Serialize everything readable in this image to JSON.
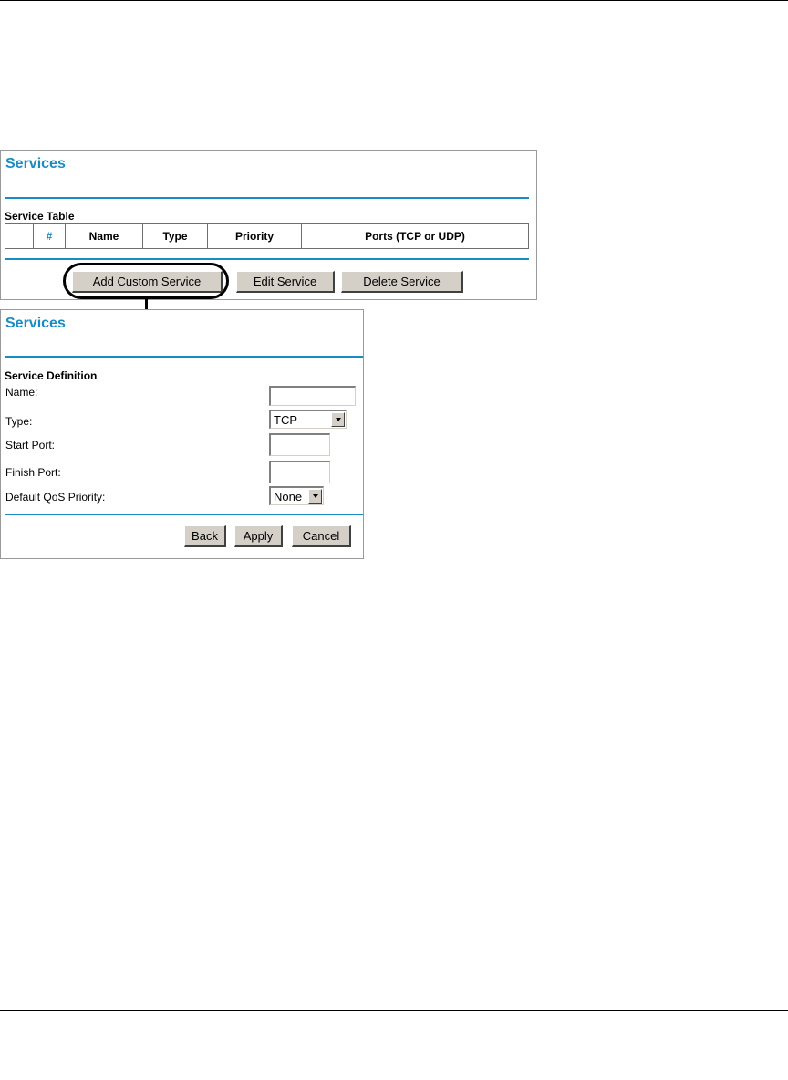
{
  "services_panel": {
    "title": "Services",
    "table_label": "Service Table",
    "columns": [
      "",
      "#",
      "Name",
      "Type",
      "Priority",
      "Ports (TCP or UDP)"
    ],
    "buttons": {
      "add": "Add Custom Service",
      "edit": "Edit Service",
      "delete": "Delete Service"
    }
  },
  "definition_panel": {
    "title": "Services",
    "section_label": "Service Definition",
    "fields": {
      "name_label": "Name:",
      "name_value": "",
      "type_label": "Type:",
      "type_value": "TCP",
      "start_port_label": "Start Port:",
      "start_port_value": "",
      "finish_port_label": "Finish Port:",
      "finish_port_value": "",
      "qos_label": "Default QoS Priority:",
      "qos_value": "None"
    },
    "buttons": {
      "back": "Back",
      "apply": "Apply",
      "cancel": "Cancel"
    }
  },
  "colors": {
    "accent": "#1a8cc4",
    "button_face": "#d4d0c8"
  }
}
